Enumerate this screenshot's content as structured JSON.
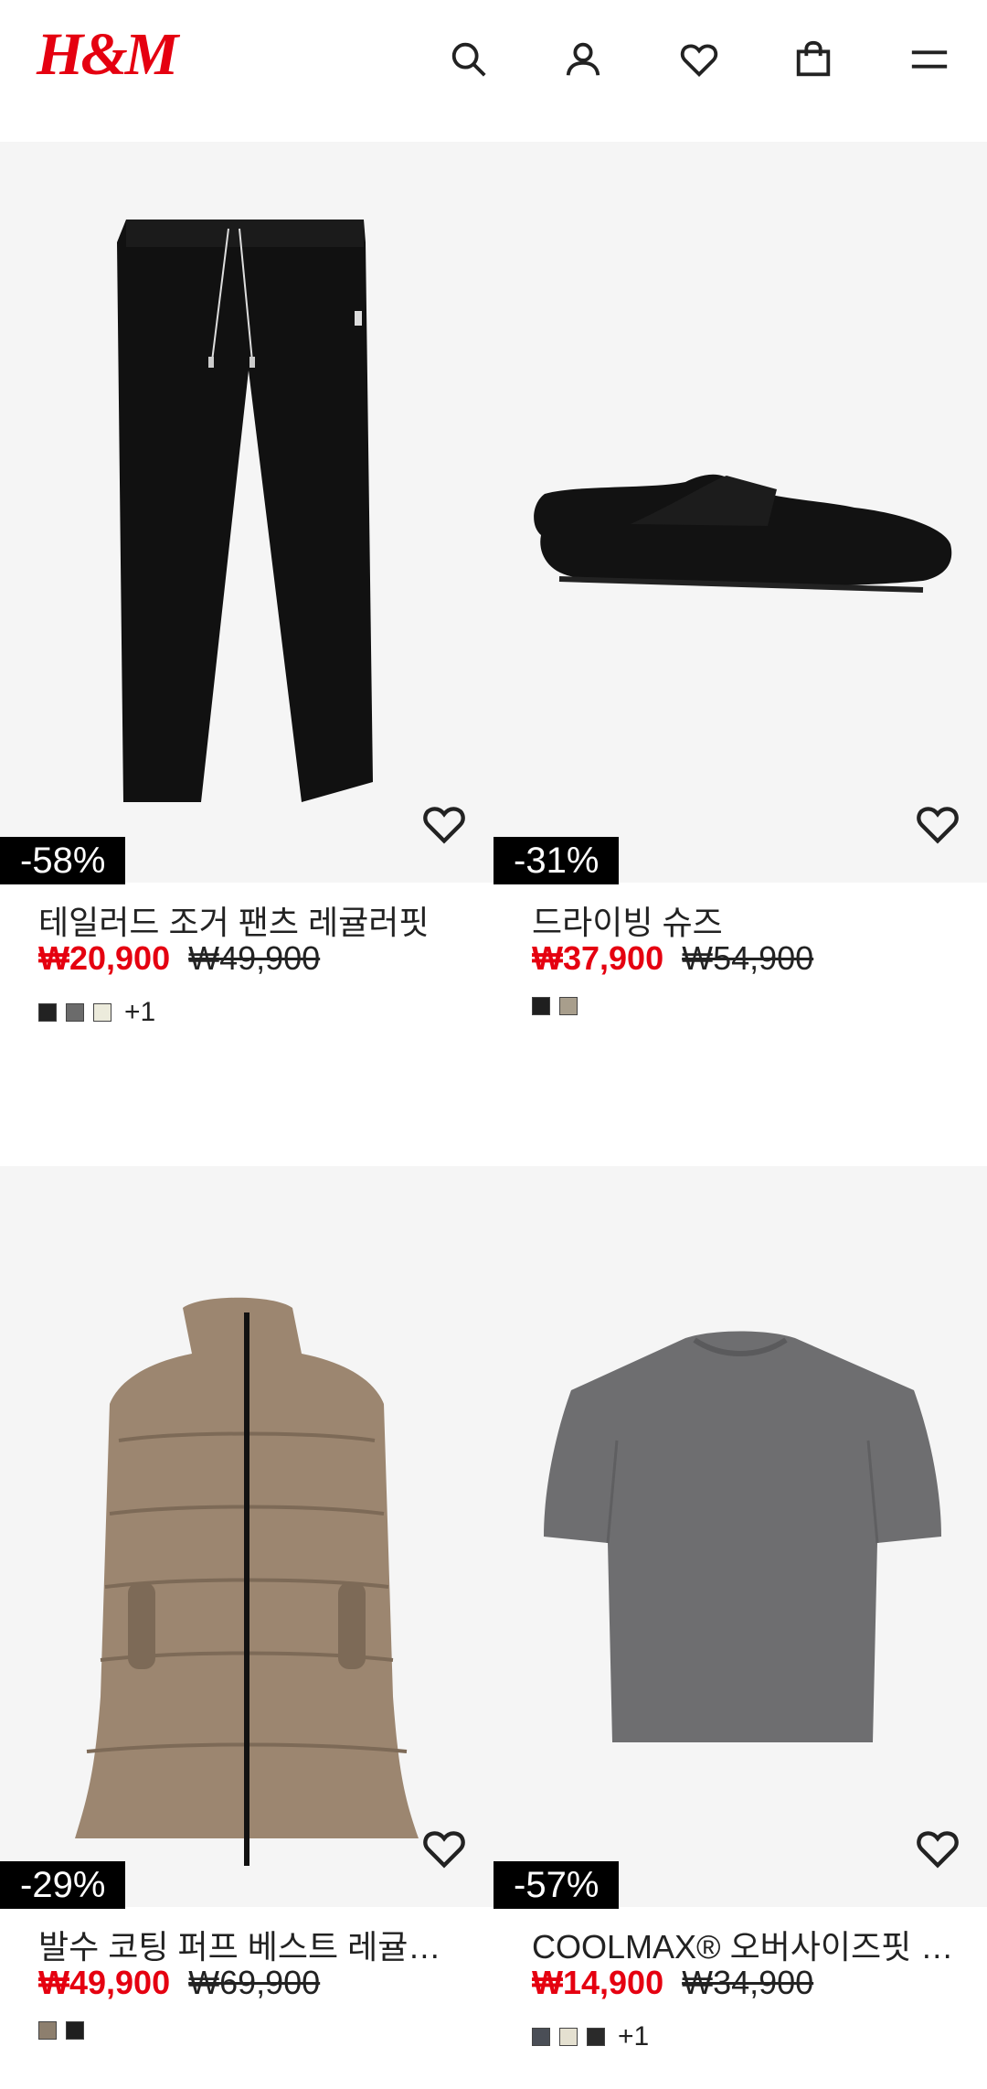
{
  "header": {
    "logo": "H&M",
    "icons": [
      "search-icon",
      "account-icon",
      "wishlist-icon",
      "bag-icon",
      "menu-icon"
    ]
  },
  "products": [
    {
      "title": "테일러드 조거 팬츠 레귤러핏",
      "sale_price": "₩20,900",
      "original_price": "₩49,900",
      "discount": "-58%",
      "swatches": [
        "#222222",
        "#6b6b6b",
        "#ecebdc"
      ],
      "more": "+1"
    },
    {
      "title": "드라이빙 슈즈",
      "sale_price": "₩37,900",
      "original_price": "₩54,900",
      "discount": "-31%",
      "swatches": [
        "#1f1f1f",
        "#a89e8c"
      ],
      "more": ""
    },
    {
      "title": "발수 코팅 퍼프 베스트 레귤…",
      "sale_price": "₩49,900",
      "original_price": "₩69,900",
      "discount": "-29%",
      "swatches": [
        "#8d7f6e",
        "#1f1f1f"
      ],
      "more": ""
    },
    {
      "title": "COOLMAX® 오버사이즈핏 …",
      "sale_price": "₩14,900",
      "original_price": "₩34,900",
      "discount": "-57%",
      "swatches": [
        "#4a4e56",
        "#e4e0d0",
        "#2a2a2a"
      ],
      "more": "+1"
    }
  ],
  "colors": {
    "accent": "#e50010",
    "badge_bg": "#000000",
    "image_bg": "#f5f5f5"
  }
}
